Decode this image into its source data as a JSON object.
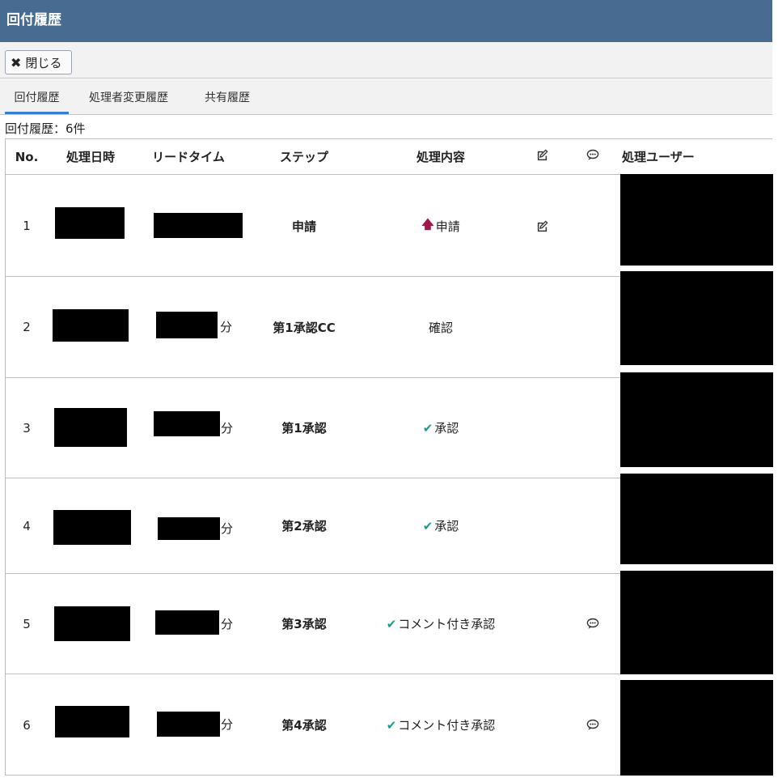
{
  "window": {
    "title": "回付履歴"
  },
  "toolbar": {
    "close_label": "閉じる"
  },
  "tabs": [
    {
      "label": "回付履歴",
      "active": true
    },
    {
      "label": "処理者変更履歴",
      "active": false
    },
    {
      "label": "共有履歴",
      "active": false
    }
  ],
  "summary": {
    "count_text": "回付履歴：6件"
  },
  "table": {
    "headers": {
      "no": "No.",
      "datetime": "処理日時",
      "leadtime": "リードタイム",
      "step": "ステップ",
      "action": "処理内容",
      "edit_icon": "edit-icon",
      "comment_icon": "comment-icon",
      "user": "処理ユーザー"
    },
    "rows": [
      {
        "no": "1",
        "leadtime_unit": "",
        "step": "申請",
        "action_icon": "arrow-up-icon",
        "action": "申請",
        "has_edit": true,
        "has_comment": false
      },
      {
        "no": "2",
        "leadtime_unit": "分",
        "step": "第1承認CC",
        "action_icon": "",
        "action": "確認",
        "has_edit": false,
        "has_comment": false
      },
      {
        "no": "3",
        "leadtime_unit": "分",
        "step": "第1承認",
        "action_icon": "check-icon",
        "action": "承認",
        "has_edit": false,
        "has_comment": false
      },
      {
        "no": "4",
        "leadtime_unit": "分",
        "step": "第2承認",
        "action_icon": "check-icon",
        "action": "承認",
        "has_edit": false,
        "has_comment": false
      },
      {
        "no": "5",
        "leadtime_unit": "分",
        "step": "第3承認",
        "action_icon": "check-icon",
        "action": "コメント付き承認",
        "has_edit": false,
        "has_comment": true
      },
      {
        "no": "6",
        "leadtime_unit": "分",
        "step": "第4承認",
        "action_icon": "check-icon",
        "action": "コメント付き承認",
        "has_edit": false,
        "has_comment": true
      }
    ]
  },
  "colors": {
    "titlebar": "#476b91",
    "tab_active_underline": "#3a7bd5",
    "arrow_up": "#a0154c",
    "check": "#1a9c8f"
  }
}
